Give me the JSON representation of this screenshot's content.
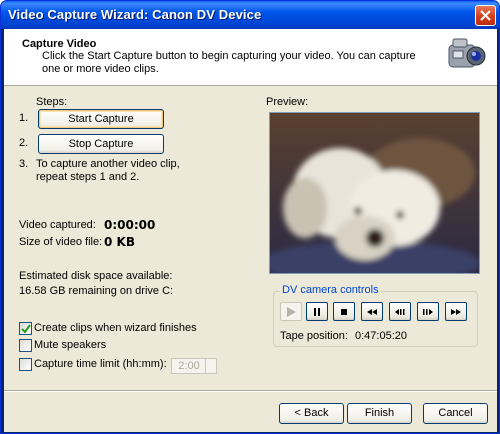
{
  "window": {
    "title": "Video Capture Wizard: Canon DV Device"
  },
  "header": {
    "title": "Capture Video",
    "description": "Click the Start Capture button to begin capturing your video. You can capture one or more video clips."
  },
  "steps": {
    "label": "Steps:",
    "n1": "1.",
    "n2": "2.",
    "n3": "3.",
    "start_capture": "Start Capture",
    "stop_capture": "Stop Capture",
    "step3_line1": "To capture another video clip,",
    "step3_line2": "repeat steps 1 and 2."
  },
  "stats": {
    "video_captured_label": "Video captured:",
    "video_captured_value": "0:00:00",
    "size_label": "Size of video file:",
    "size_value": "0 KB",
    "disk_label": "Estimated disk space available:",
    "disk_value": "16.58 GB remaining on drive C:"
  },
  "options": {
    "create_clips": {
      "label": "Create clips when wizard finishes",
      "checked": true
    },
    "mute": {
      "label": "Mute speakers",
      "checked": false
    },
    "time_limit": {
      "label": "Capture time limit (hh:mm):",
      "checked": false,
      "value": "2:00"
    }
  },
  "preview": {
    "label": "Preview:"
  },
  "dv_controls": {
    "title": "DV camera controls",
    "buttons": [
      "play-icon",
      "pause-icon",
      "stop-icon",
      "rewind-icon",
      "step-back-icon",
      "step-forward-icon",
      "fast-forward-icon"
    ],
    "tape_label": "Tape position:",
    "tape_value": "0:47:05:20"
  },
  "footer": {
    "back": "Back",
    "finish": "Finish",
    "cancel": "Cancel"
  }
}
